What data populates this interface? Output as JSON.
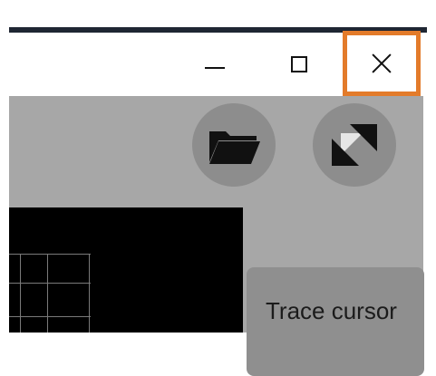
{
  "window_controls": {
    "minimize_icon": "minimize-icon",
    "maximize_icon": "maximize-icon",
    "close_icon": "close-icon",
    "close_highlight_color": "#e37b2a"
  },
  "toolbar": {
    "open_icon": "folder-open-icon",
    "fit_icon": "fit-to-screen-icon"
  },
  "panel": {
    "trace_cursor_label": "Trace cursor"
  }
}
